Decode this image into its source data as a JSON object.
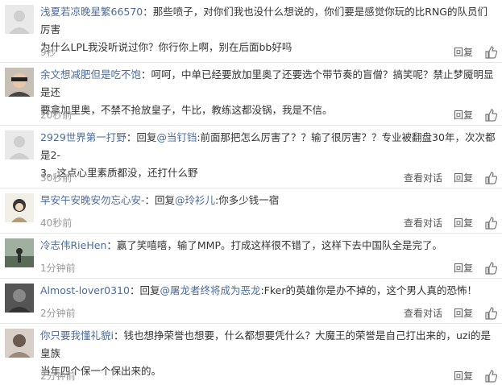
{
  "comments": [
    {
      "user": "浅夏若凉晚星繁66570",
      "reply_prefix": "",
      "reply_to": "",
      "text_line1": "：那些喷子，对你们我也没什么想说的，你们要是感觉你玩的比RNG的队员们厉害",
      "text_line2": "为什么LPL我没听说过你？你行你上啊，别在后面bb好吗",
      "time": "9秒",
      "view_thread": "",
      "reply": "回复"
    },
    {
      "user": "余文想减肥但是吃不饱",
      "reply_prefix": "",
      "reply_to": "",
      "text_line1": "：呵呵，中单已经要放加里奥了还要选个带节奏的盲僧？搞笑呢？禁止梦魇明显是还",
      "text_line2": "要拿加里奥，不禁不抢放皇子，牛比，教练这都没锅，我是不信。",
      "time": "20秒前",
      "view_thread": "",
      "reply": "回复"
    },
    {
      "user": "2929世界第一打野",
      "reply_prefix": "：回复",
      "reply_to": "@当钉铛",
      "text_line1": ":前面那把怎么厉害了？？输了很厉害？？专业被翻盘30年，次次都是2-",
      "text_line2": "3。这点心里素质都没，还打什么野",
      "time": "30秒前",
      "view_thread": "查看对话",
      "reply": "回复"
    },
    {
      "user": "早安午安晚安勿忘心安-",
      "reply_prefix": "：回复",
      "reply_to": "@玲衫儿",
      "text_line1": ":你多少钱一宿",
      "text_line2": "",
      "time": "40秒前",
      "view_thread": "查看对话",
      "reply": "回复"
    },
    {
      "user": "冷志伟RieHen",
      "reply_prefix": "",
      "reply_to": "",
      "text_line1": "：赢了笑嘻嘻，输了MMP。打成这样很不错了，这样下去中国队全是完了。",
      "text_line2": "",
      "time": "1分钟前",
      "view_thread": "",
      "reply": "回复"
    },
    {
      "user": "Almost-lover0310",
      "reply_prefix": "：回复",
      "reply_to": "@屠龙者终将成为恶龙",
      "text_line1": ":Fker的英雄你是办不掉的，这个男人真的恐怖！",
      "text_line2": "",
      "time": "2分钟前",
      "view_thread": "查看对话",
      "reply": "回复"
    },
    {
      "user": "你只要我懂礼貌i",
      "reply_prefix": "",
      "reply_to": "",
      "text_line1": "：钱也想挣荣誉也想要，什么都想要凭什么？大魔王的荣誉是自己打出来的，uzi的是皇族",
      "text_line2": "当年四个保一个保出来的。",
      "time": "2分钟前",
      "view_thread": "",
      "reply": "回复"
    }
  ]
}
